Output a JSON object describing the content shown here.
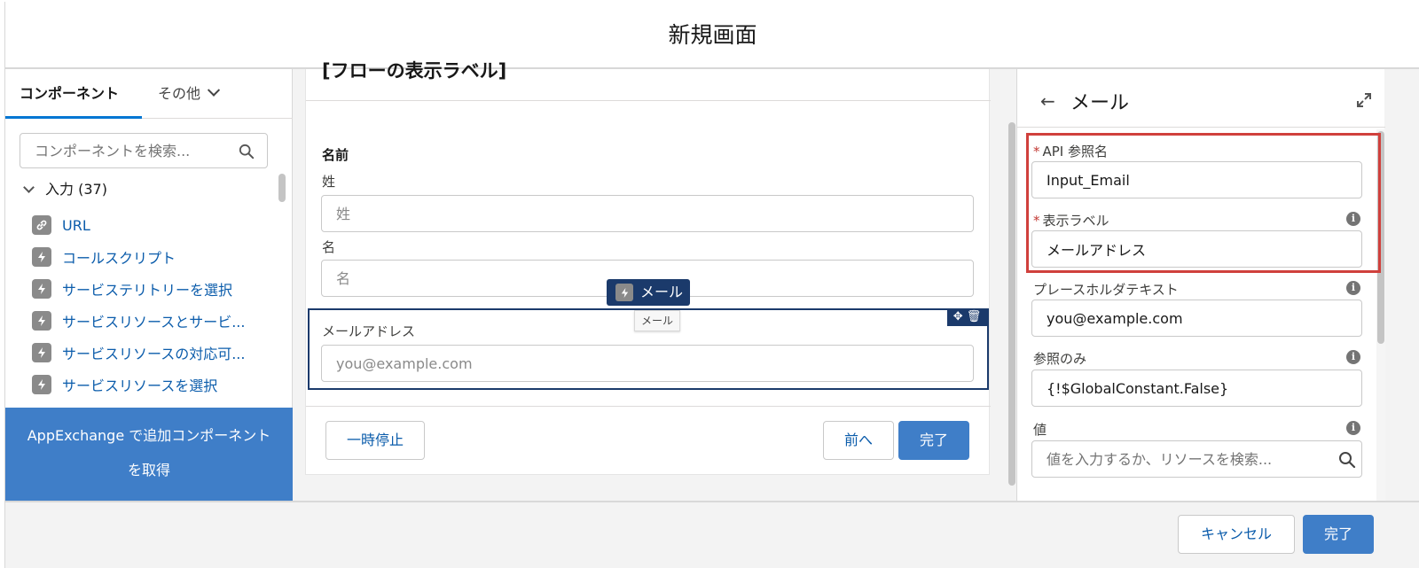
{
  "modal": {
    "title": "新規画面"
  },
  "left_panel": {
    "tabs": [
      {
        "label": "コンポーネント"
      },
      {
        "label": "その他"
      }
    ],
    "search_placeholder": "コンポーネントを検索...",
    "section": {
      "label": "入力 (37)"
    },
    "items": [
      {
        "label": "URL",
        "icon": "link-icon"
      },
      {
        "label": "コールスクリプト",
        "icon": "lightning-icon"
      },
      {
        "label": "サービステリトリーを選択",
        "icon": "lightning-icon"
      },
      {
        "label": "サービスリソースとサービ...",
        "icon": "lightning-icon"
      },
      {
        "label": "サービスリソースの対応可...",
        "icon": "lightning-icon"
      },
      {
        "label": "サービスリソースを選択",
        "icon": "lightning-icon"
      }
    ],
    "appexchange_label": "AppExchange で追加コンポーネントを取得"
  },
  "canvas": {
    "screen_title": "[フローの表示ラベル]",
    "name_label": "名前",
    "last_name": {
      "label": "姓",
      "placeholder": "姓"
    },
    "first_name": {
      "label": "名",
      "placeholder": "名"
    },
    "email": {
      "label": "メールアドレス",
      "placeholder": "you@example.com"
    },
    "drag_chip": "メール",
    "tooltip": "メール",
    "buttons": {
      "pause": "一時停止",
      "previous": "前へ",
      "finish": "完了"
    }
  },
  "right_panel": {
    "title": "メール",
    "api_name": {
      "label": "API 参照名",
      "value": "Input_Email",
      "required": "*"
    },
    "display_label": {
      "label": "表示ラベル",
      "value": "メールアドレス",
      "required": "*"
    },
    "placeholder_text": {
      "label": "プレースホルダテキスト",
      "value": "you@example.com"
    },
    "read_only": {
      "label": "参照のみ",
      "value": "{!$GlobalConstant.False}"
    },
    "value_field": {
      "label": "値",
      "placeholder": "値を入力するか、リソースを検索..."
    }
  },
  "footer": {
    "cancel_label": "キャンセル",
    "done_label": "完了"
  },
  "colors": {
    "brand": "#3f7ec8",
    "link": "#0b5cab",
    "highlight": "#d0403c",
    "selection": "#1b3a6b"
  }
}
